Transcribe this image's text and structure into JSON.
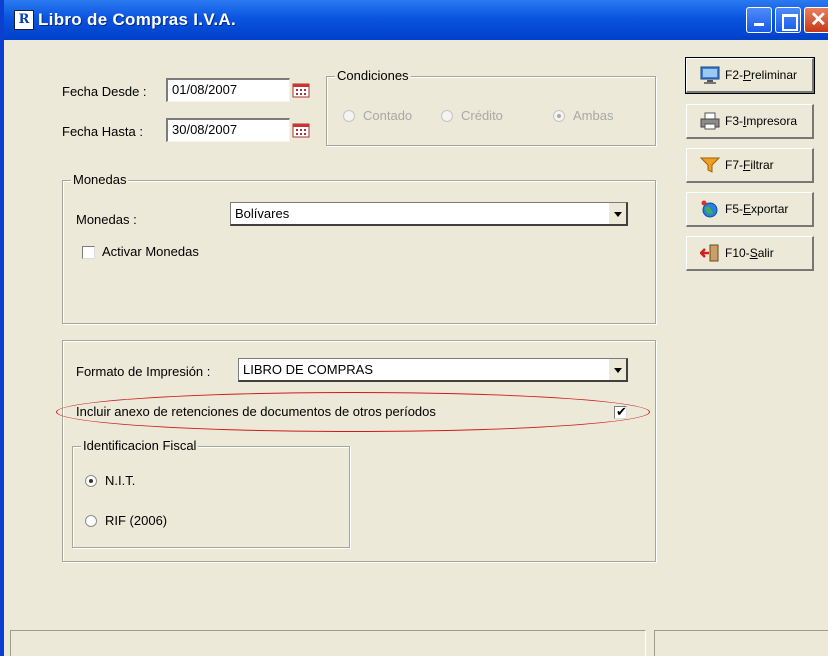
{
  "window": {
    "title": "Libro de Compras I.V.A.",
    "app_icon_glyph": "R"
  },
  "dates": {
    "desde_label": "Fecha Desde :",
    "desde_value": "01/08/2007",
    "hasta_label": "Fecha Hasta :",
    "hasta_value": "30/08/2007"
  },
  "condiciones": {
    "title": "Condiciones",
    "options": [
      "Contado",
      "Crédito",
      "Ambas"
    ],
    "selected": "Ambas",
    "enabled": false
  },
  "monedas": {
    "group_title": "Monedas",
    "label": "Monedas :",
    "value": "Bolívares",
    "activar_label": "Activar Monedas",
    "activar_checked": false
  },
  "formato": {
    "label": "Formato de Impresión :",
    "value": "LIBRO DE COMPRAS"
  },
  "incluir": {
    "label": "Incluir anexo de retenciones de documentos de otros períodos",
    "checked": true,
    "check_glyph": "✔"
  },
  "identificacion": {
    "title": "Identificacion Fiscal",
    "options": [
      "N.I.T.",
      "RIF (2006)"
    ],
    "selected": "N.I.T."
  },
  "buttons": [
    {
      "prefix": "F2-",
      "key": "P",
      "rest": "reliminar",
      "icon": "monitor-icon",
      "default": true
    },
    {
      "prefix": "F3-",
      "key": "I",
      "rest": "mpresora",
      "icon": "printer-icon"
    },
    {
      "prefix": "F7-",
      "key": "F",
      "rest": "iltrar",
      "icon": "funnel-icon"
    },
    {
      "prefix": "F5-",
      "key": "E",
      "rest": "xportar",
      "icon": "globe-icon"
    },
    {
      "prefix": "F10-",
      "key": "S",
      "rest": "alir",
      "icon": "exit-door-icon"
    }
  ],
  "colors": {
    "titlebar": "#0a54e0",
    "window_bg": "#ece9d8",
    "highlight_ellipse": "#cc1c1c",
    "close_button": "#c6381a"
  }
}
